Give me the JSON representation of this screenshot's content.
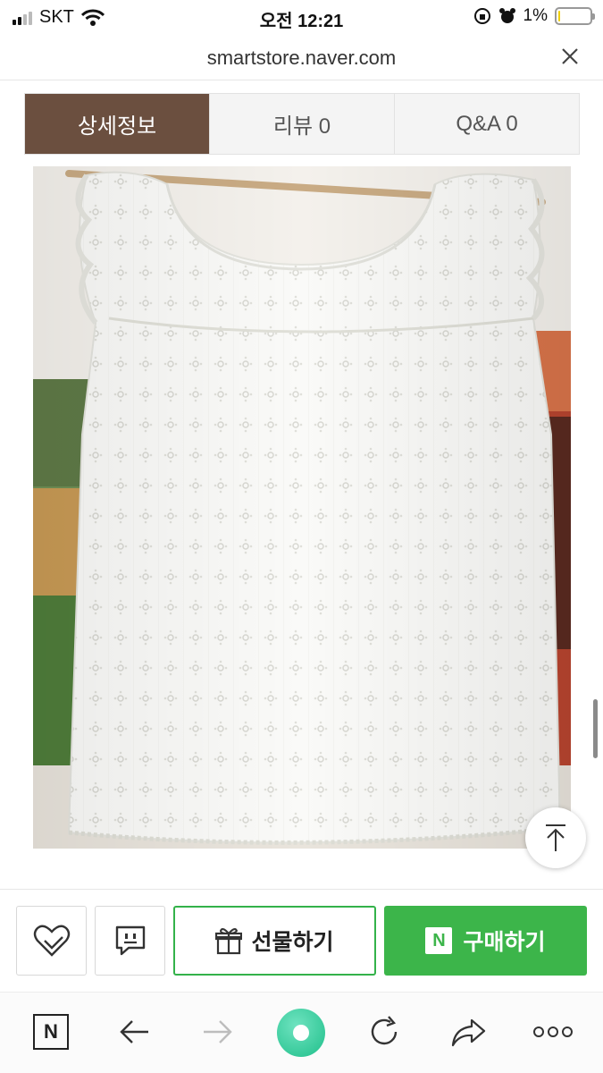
{
  "status": {
    "carrier": "SKT",
    "time": "오전 12:21",
    "battery": "1%",
    "battery_level": 0.01
  },
  "browser": {
    "url": "smartstore.naver.com"
  },
  "tabs": [
    {
      "label": "상세정보",
      "active": true
    },
    {
      "label": "리뷰  0",
      "active": false
    },
    {
      "label": "Q&A  0",
      "active": false
    }
  ],
  "actions": {
    "gift_label": "선물하기",
    "buy_label": "구매하기",
    "buy_badge": "N"
  },
  "bottom_bar": {
    "home_logo": "N"
  },
  "colors": {
    "tab_active": "#6b4f3f",
    "buy": "#3cb54a"
  }
}
